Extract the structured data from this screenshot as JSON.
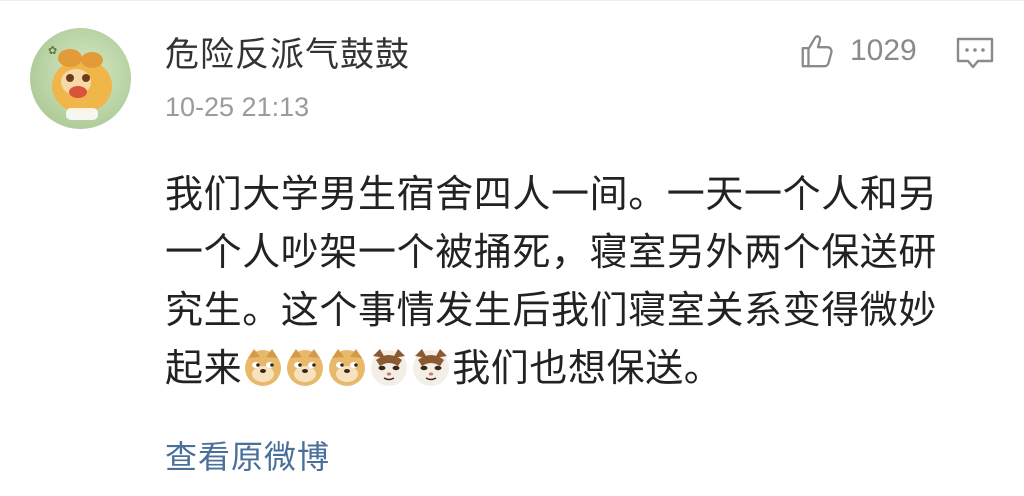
{
  "comment": {
    "username": "危险反派气鼓鼓",
    "timestamp": "10-25 21:13",
    "like_count": "1029",
    "content_lines": [
      "我们大学男生宿舍四人一间。一天一个人和另",
      "一个人吵架一个被捅死，寝室另外两个保送研",
      "究生。这个事情发生后我们寝室关系变得微妙"
    ],
    "last_line_prefix": "起来",
    "last_line_suffix": "我们也想保送。",
    "emojis": [
      "doge-emoji",
      "doge-emoji",
      "doge-emoji",
      "cat-emoji",
      "cat-emoji"
    ],
    "view_original_label": "查看原微博"
  },
  "icons": {
    "like": "thumbs-up-icon",
    "comment": "comment-bubble-icon"
  },
  "colors": {
    "username": "#333333",
    "timestamp": "#9b9b9b",
    "body_text": "#222222",
    "link": "#4a6f9a",
    "icon_gray": "#8a8a8a"
  }
}
